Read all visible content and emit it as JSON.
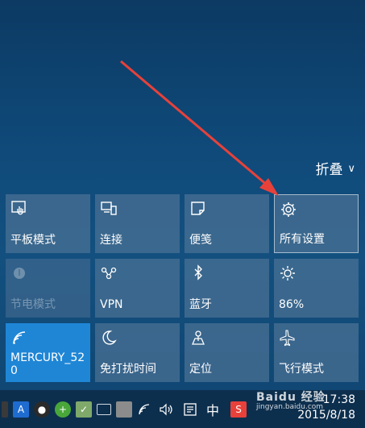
{
  "collapse": {
    "label": "折叠",
    "icon": "chevron-down-icon"
  },
  "tiles": [
    {
      "label": "平板模式",
      "icon": "tablet-mode-icon",
      "state": "normal"
    },
    {
      "label": "连接",
      "icon": "connect-icon",
      "state": "normal"
    },
    {
      "label": "便笺",
      "icon": "note-icon",
      "state": "normal"
    },
    {
      "label": "所有设置",
      "icon": "gear-icon",
      "state": "highlight"
    },
    {
      "label": "节电模式",
      "icon": "battery-saver-icon",
      "state": "disabled"
    },
    {
      "label": "VPN",
      "icon": "vpn-icon",
      "state": "normal"
    },
    {
      "label": "蓝牙",
      "icon": "bluetooth-icon",
      "state": "normal"
    },
    {
      "label": "86%",
      "icon": "brightness-icon",
      "state": "normal"
    },
    {
      "label": "MERCURY_520",
      "icon": "wifi-icon",
      "state": "active"
    },
    {
      "label": "免打扰时间",
      "icon": "moon-icon",
      "state": "normal"
    },
    {
      "label": "定位",
      "icon": "location-icon",
      "state": "normal"
    },
    {
      "label": "飞行模式",
      "icon": "airplane-icon",
      "state": "normal"
    }
  ],
  "taskbar": {
    "ime": "中",
    "time": "17:38",
    "date": "2015/8/18",
    "watermark": "Baidu 经验",
    "watermark_sub": "jingyan.baidu.com"
  },
  "colors": {
    "tile": "#4a7094",
    "tile_active": "#1f86d6",
    "arrow": "#e8413a",
    "taskbar": "#0d2f4e"
  }
}
